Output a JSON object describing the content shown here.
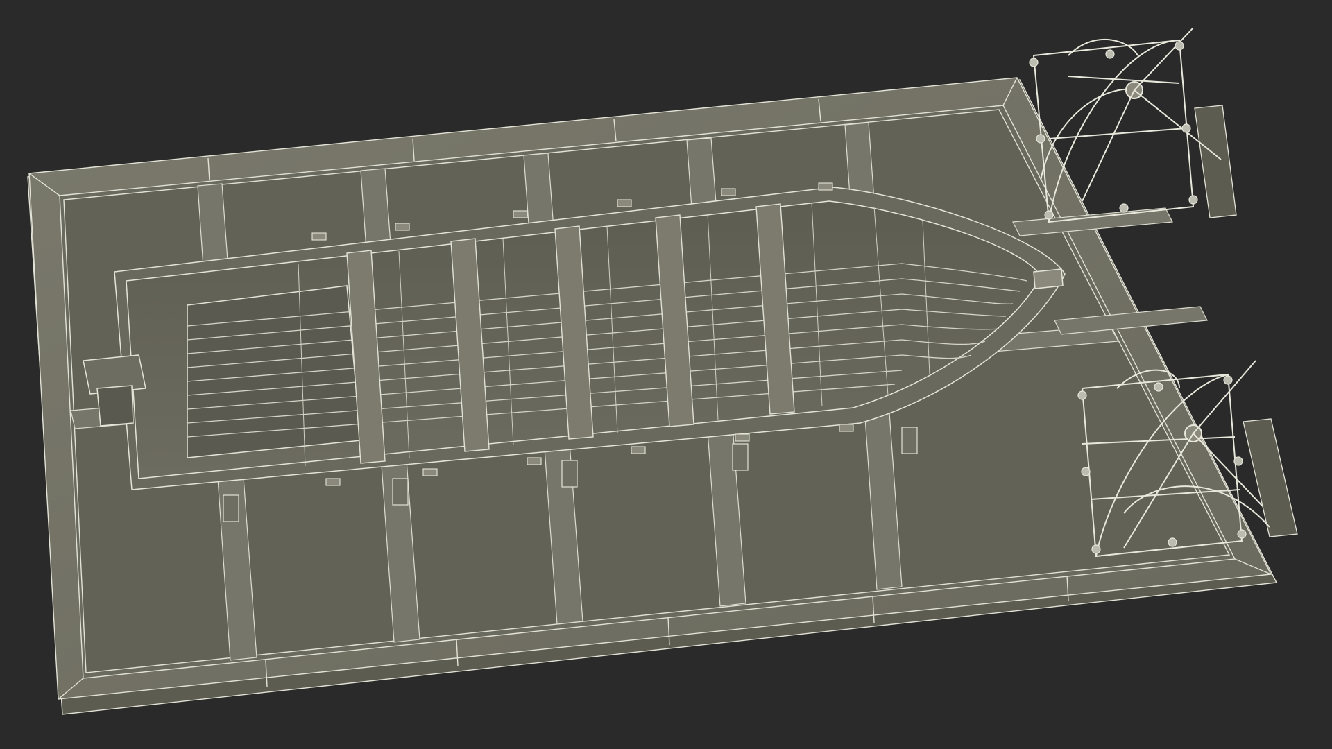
{
  "scene": {
    "description_visible_text": "",
    "colors": {
      "background": "#2a2a2a",
      "surface": "#6e6d61",
      "surface_dark": "#5b5a50",
      "surface_light": "#8b8a7c",
      "edge": "#e4e4d8",
      "wire": "#d8d8cc"
    }
  }
}
